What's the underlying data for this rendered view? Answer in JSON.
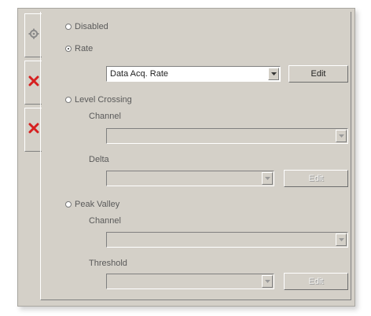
{
  "modes": {
    "disabled_label": "Disabled",
    "rate_label": "Rate",
    "level_crossing_label": "Level Crossing",
    "peak_valley_label": "Peak Valley",
    "selected": "Rate"
  },
  "rate": {
    "selected_value": "Data Acq. Rate",
    "edit_button": "Edit"
  },
  "level_crossing": {
    "channel_label": "Channel",
    "channel_value": "",
    "delta_label": "Delta",
    "delta_value": "",
    "edit_button": "Edit"
  },
  "peak_valley": {
    "channel_label": "Channel",
    "channel_value": "",
    "threshold_label": "Threshold",
    "threshold_value": "",
    "edit_button": "Edit"
  },
  "sidebar": {
    "items": [
      {
        "icon": "gear-icon",
        "state": "selected"
      },
      {
        "icon": "close-icon",
        "color": "#d62020"
      },
      {
        "icon": "close-icon",
        "color": "#d62020"
      }
    ]
  }
}
